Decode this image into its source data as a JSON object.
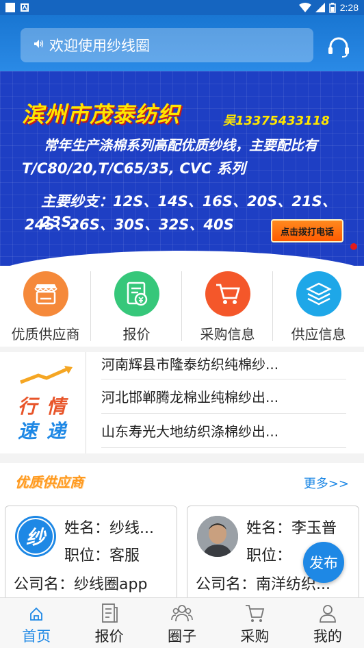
{
  "status_bar": {
    "time": "2:28",
    "icons": [
      "square-icon",
      "a-icon",
      "wifi-icon",
      "signal-icon",
      "battery-icon"
    ]
  },
  "header": {
    "search_text": "欢迎使用纱线圈",
    "icons": [
      "speaker-icon",
      "headset-icon"
    ]
  },
  "banner": {
    "company": "滨州市茂泰纺织",
    "phone": "吴13375433118",
    "line1": "常年生产涤棉系列高配优质纱线，主要配比有",
    "line2": "T/C80/20,T/C65/35, CVC 系列",
    "line3": "主要纱支：12S、14S、16S、20S、21S、23S、",
    "line4": "24S、26S、30S、32S、40S",
    "call_button": "点击拨打电话"
  },
  "categories": [
    {
      "label": "优质供应商",
      "icon": "store-icon",
      "color": "#f5893a"
    },
    {
      "label": "报价",
      "icon": "quote-icon",
      "color": "#36c77a"
    },
    {
      "label": "采购信息",
      "icon": "cart-icon",
      "color": "#f4572a"
    },
    {
      "label": "供应信息",
      "icon": "layers-icon",
      "color": "#1ea7e8"
    }
  ],
  "news": {
    "logo_top": "行情",
    "logo_bottom": "速递",
    "items": [
      "河南辉县市隆泰纺织纯棉纱...",
      "河北邯郸腾龙棉业纯棉纱出...",
      "山东寿光大地纺织涤棉纱出..."
    ]
  },
  "suppliers": {
    "title": "优质供应商",
    "more": "更多>>",
    "cards": [
      {
        "name": "姓名：纱线...",
        "position": "职位：客服",
        "company": "公司名：纱线圈app",
        "avatar_text": "纱"
      },
      {
        "name": "姓名：李玉普",
        "position": "职位：",
        "company": "公司名：南洋纺织...",
        "avatar_text": ""
      }
    ]
  },
  "publish_button": "发布",
  "tabs": [
    {
      "label": "首页",
      "icon": "home-icon",
      "active": true
    },
    {
      "label": "报价",
      "icon": "document-icon",
      "active": false
    },
    {
      "label": "圈子",
      "icon": "people-icon",
      "active": false
    },
    {
      "label": "采购",
      "icon": "cart-icon",
      "active": false
    },
    {
      "label": "我的",
      "icon": "user-icon",
      "active": false
    }
  ],
  "colors": {
    "primary": "#1e88e5",
    "banner_bg": "#1e3fc4",
    "accent_orange": "#ff9a1f"
  }
}
